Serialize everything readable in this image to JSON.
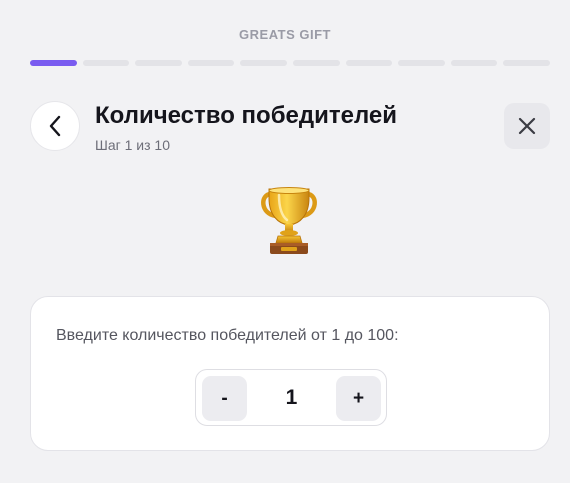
{
  "app": {
    "brand": "GREATS GIFT"
  },
  "progress": {
    "current": 1,
    "total": 10
  },
  "header": {
    "title": "Количество победителей",
    "step_text": "Шаг 1 из 10",
    "back_icon": "chevron-left-icon",
    "close_icon": "close-icon"
  },
  "hero": {
    "icon": "trophy-icon",
    "emoji": "🏆"
  },
  "winners_card": {
    "prompt": "Введите количество победителей от 1 до 100:",
    "decrement_label": "-",
    "increment_label": "+",
    "value": "1"
  },
  "colors": {
    "accent": "#7a5cf0",
    "background": "#f2f2f4",
    "card": "#ffffff",
    "segment_inactive": "#e3e3e7"
  }
}
